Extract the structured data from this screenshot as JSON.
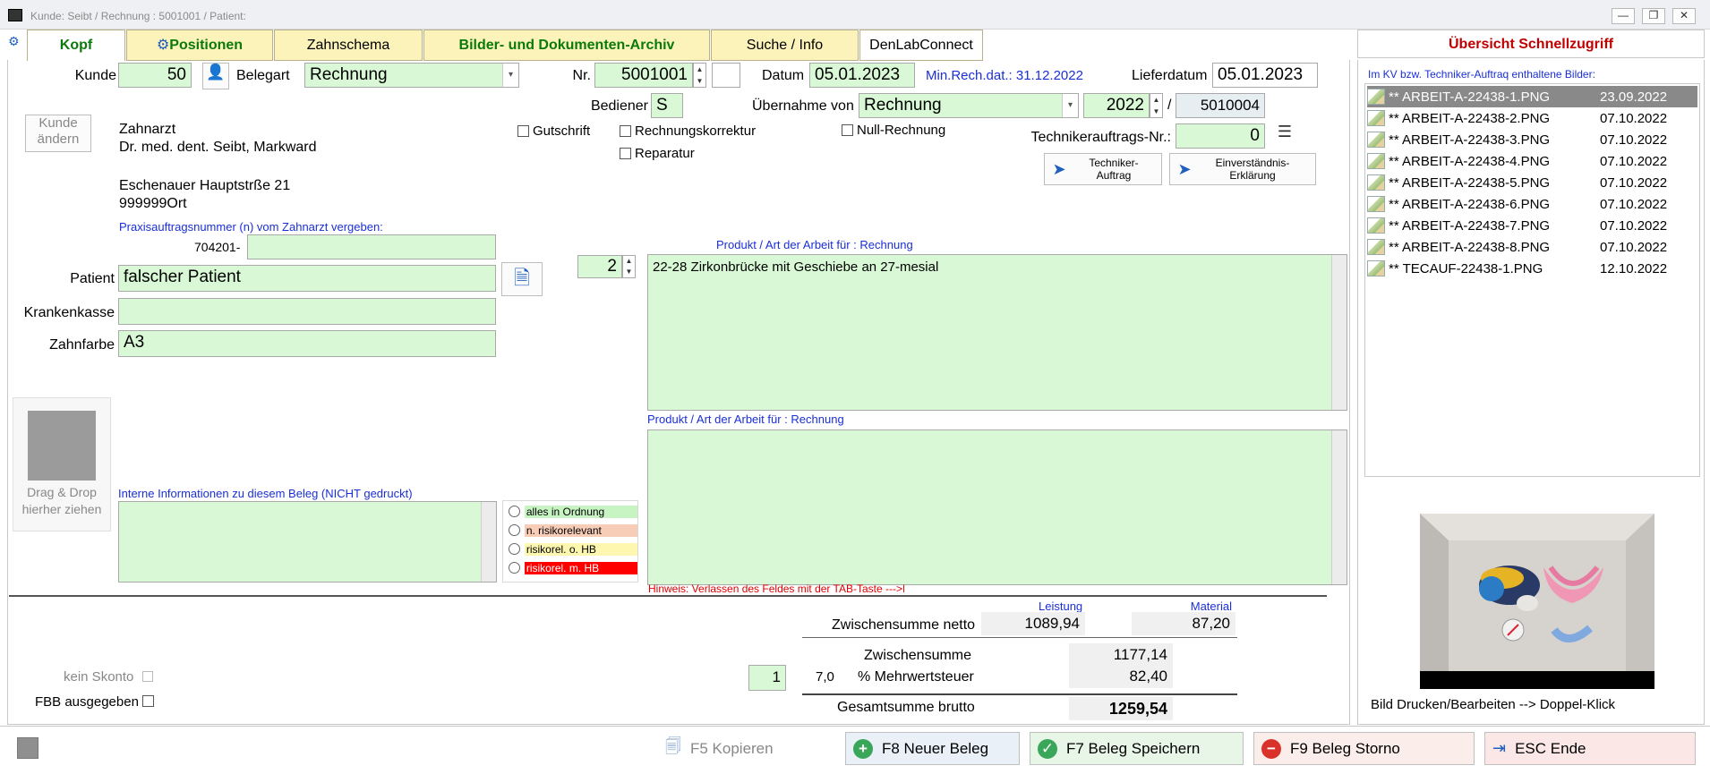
{
  "window": {
    "title": "Kunde: Seibt  / Rechnung : 5001001 / Patient:",
    "minimize": "—",
    "restore": "❐",
    "close": "✕"
  },
  "tabs": [
    {
      "label": "Kopf"
    },
    {
      "label": "Positionen"
    },
    {
      "label": "Zahnschema"
    },
    {
      "label": "Bilder- und Dokumenten-Archiv"
    },
    {
      "label": "Suche / Info"
    },
    {
      "label": "DenLabConnect"
    }
  ],
  "header": {
    "kunde_label": "Kunde",
    "kunde_value": "50",
    "belegart_label": "Belegart",
    "belegart_value": "Rechnung",
    "nr_label": "Nr.",
    "nr_value": "5001001",
    "datum_label": "Datum",
    "datum_value": "05.01.2023",
    "min_rech_dat": "Min.Rech.dat.: 31.12.2022",
    "lieferdatum_label": "Lieferdatum",
    "lieferdatum_value": "05.01.2023",
    "bediener_label": "Bediener",
    "bediener_value": "S",
    "uebernahme_label": "Übernahme von",
    "uebernahme_value": "Rechnung",
    "uebernahme_year": "2022",
    "uebernahme_nr": "5010004",
    "techniker_nr_label": "Technikerauftrags-Nr.:",
    "techniker_nr_value": "0"
  },
  "checkboxes": {
    "gutschrift": "Gutschrift",
    "rechnungskorrektur": "Rechnungskorrektur",
    "reparatur": "Reparatur",
    "null_rechnung": "Null-Rechnung"
  },
  "buttons": {
    "kunde_aendern": "Kunde ändern",
    "techniker_auftrag": "Techniker-Auftrag",
    "einverstaendnis": "Einverständnis-Erklärung",
    "drag_drop": "Drag & Drop hierher ziehen"
  },
  "customer": {
    "line1": "Zahnarzt",
    "line2": "Dr. med. dent. Seibt, Markward",
    "line3": "Eschenauer Hauptstrße 21",
    "line4": "999999Ort"
  },
  "praxis": {
    "label": "Praxisauftragsnummer (n) vom Zahnarzt vergeben:",
    "prefix": "704201-",
    "value": ""
  },
  "patient": {
    "patient_label": "Patient",
    "patient_value": "falscher Patient",
    "krankenkasse_label": "Krankenkasse",
    "krankenkasse_value": "",
    "zahnfarbe_label": "Zahnfarbe",
    "zahnfarbe_value": "A3"
  },
  "product": {
    "count": "2",
    "label1": "Produkt / Art der Arbeit für : Rechnung",
    "text1": "22-28 Zirkonbrücke mit Geschiebe an 27-mesial",
    "label2": "Produkt / Art der Arbeit für : Rechnung",
    "text2": "",
    "hint": "Hinweis: Verlassen des Feldes mit der TAB-Taste --->|"
  },
  "intern": {
    "label": "Interne Informationen zu diesem Beleg (NICHT gedruckt)",
    "value": ""
  },
  "risk": [
    {
      "label": "alles in Ordnung",
      "color": "#c8f4c4"
    },
    {
      "label": "n. risikorelevant",
      "color": "#f7cdb8"
    },
    {
      "label": "risikorel. o. HB",
      "color": "#fdf7b0"
    },
    {
      "label": "risikorel. m. HB",
      "color": "#ff0000"
    }
  ],
  "totals": {
    "leistung_label": "Leistung",
    "material_label": "Material",
    "zwischensumme_netto_label": "Zwischensumme netto",
    "netto_leistung": "1089,94",
    "netto_material": "87,20",
    "zwischensumme_label": "Zwischensumme",
    "zwischensumme_value": "1177,14",
    "mwst_code": "1",
    "mwst_rate": "7,0",
    "mwst_label": "% Mehrwertsteuer",
    "mwst_value": "82,40",
    "brutto_label": "Gesamtsumme brutto",
    "brutto_value": "1259,54"
  },
  "bottom_left": {
    "kein_skonto": "kein Skonto",
    "fbb": "FBB ausgegeben"
  },
  "quick_panel": {
    "title": "Übersicht Schnellzugriff",
    "list_label": "Im KV bzw. Techniker-Auftraq enthaltene Bilder:",
    "images": [
      {
        "name": "** ARBEIT-A-22438-1.PNG",
        "date": "23.09.2022"
      },
      {
        "name": "** ARBEIT-A-22438-2.PNG",
        "date": "07.10.2022"
      },
      {
        "name": "** ARBEIT-A-22438-3.PNG",
        "date": "07.10.2022"
      },
      {
        "name": "** ARBEIT-A-22438-4.PNG",
        "date": "07.10.2022"
      },
      {
        "name": "** ARBEIT-A-22438-5.PNG",
        "date": "07.10.2022"
      },
      {
        "name": "** ARBEIT-A-22438-6.PNG",
        "date": "07.10.2022"
      },
      {
        "name": "** ARBEIT-A-22438-7.PNG",
        "date": "07.10.2022"
      },
      {
        "name": "** ARBEIT-A-22438-8.PNG",
        "date": "07.10.2022"
      },
      {
        "name": "** TECAUF-22438-1.PNG",
        "date": "12.10.2022"
      }
    ],
    "print_hint": "Bild Drucken/Bearbeiten --> Doppel-Klick"
  },
  "footer": {
    "kopieren": "F5 Kopieren",
    "neuer_beleg": "F8 Neuer Beleg",
    "speichern": "F7 Beleg Speichern",
    "storno": "F9 Beleg Storno",
    "ende": "ESC Ende"
  }
}
